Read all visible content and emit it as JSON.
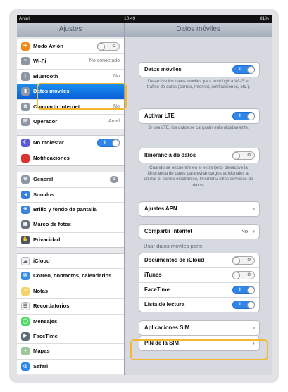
{
  "status_bar": {
    "carrier": "Antel",
    "time": "10:49",
    "battery": "81%"
  },
  "sidebar": {
    "title": "Ajustes",
    "groups": [
      [
        {
          "label": "Modo Avión",
          "icon": "airplane-icon",
          "toggle": "off"
        },
        {
          "label": "Wi-Fi",
          "icon": "wifi-icon",
          "value": "No conectado"
        },
        {
          "label": "Bluetooth",
          "icon": "bluetooth-icon",
          "value": "No"
        },
        {
          "label": "Datos móviles",
          "icon": "cellular-data-icon",
          "selected": true
        },
        {
          "label": "Compartir Internet",
          "icon": "personal-hotspot-icon",
          "value": "No"
        },
        {
          "label": "Operador",
          "icon": "carrier-icon",
          "value": "Antel"
        }
      ],
      [
        {
          "label": "No molestar",
          "icon": "moon-icon",
          "toggle": "on"
        },
        {
          "label": "Notificaciones",
          "icon": "notifications-icon"
        }
      ],
      [
        {
          "label": "General",
          "icon": "gear-icon",
          "badge": "1"
        },
        {
          "label": "Sonidos",
          "icon": "speaker-icon"
        },
        {
          "label": "Brillo y fondo de pantalla",
          "icon": "brightness-icon"
        },
        {
          "label": "Marco de fotos",
          "icon": "picture-frame-icon"
        },
        {
          "label": "Privacidad",
          "icon": "hand-icon"
        }
      ],
      [
        {
          "label": "iCloud",
          "icon": "cloud-icon"
        },
        {
          "label": "Correo, contactos, calendarios",
          "icon": "mail-icon"
        },
        {
          "label": "Notas",
          "icon": "notes-icon"
        },
        {
          "label": "Recordatorios",
          "icon": "reminders-icon"
        },
        {
          "label": "Mensajes",
          "icon": "messages-icon"
        },
        {
          "label": "FaceTime",
          "icon": "facetime-icon"
        },
        {
          "label": "Mapas",
          "icon": "maps-icon"
        },
        {
          "label": "Safari",
          "icon": "safari-icon"
        }
      ]
    ]
  },
  "detail": {
    "title": "Datos móviles",
    "datos_moviles": {
      "label": "Datos móviles",
      "toggle": "on"
    },
    "datos_moviles_note": "Desactive los datos móviles para restringir a Wi-Fi el tráfico de datos (correo, Internet, notificaciones, etc.).",
    "lte": {
      "label": "Activar LTE",
      "toggle": "on"
    },
    "lte_note": "Si usa LTE, los datos se cargarán más rápidamente.",
    "roaming": {
      "label": "Itinerancia de datos",
      "toggle": "off"
    },
    "roaming_note": "Cuando se encuentre en el extranjero, desactive la itinerancia de datos para evitar cargos adicionales al utilizar el correo electrónico, Internet u otros servicios de datos.",
    "apn": {
      "label": "Ajustes APN"
    },
    "hotspot": {
      "label": "Compartir Internet",
      "value": "No"
    },
    "usage_header": "Usar datos móviles para:",
    "usage_items": [
      {
        "label": "Documentos de iCloud",
        "toggle": "off"
      },
      {
        "label": "iTunes",
        "toggle": "off"
      },
      {
        "label": "FaceTime",
        "toggle": "on"
      },
      {
        "label": "Lista de lectura",
        "toggle": "on"
      }
    ],
    "sim_apps": {
      "label": "Aplicaciones SIM"
    },
    "sim_pin": {
      "label": "PIN de la SIM"
    }
  },
  "toggle_marks": {
    "on": "I",
    "off": "O"
  },
  "colors": {
    "accent": "#2f86e8",
    "highlight": "#f5b731",
    "selected_row": "#1a73e8"
  }
}
